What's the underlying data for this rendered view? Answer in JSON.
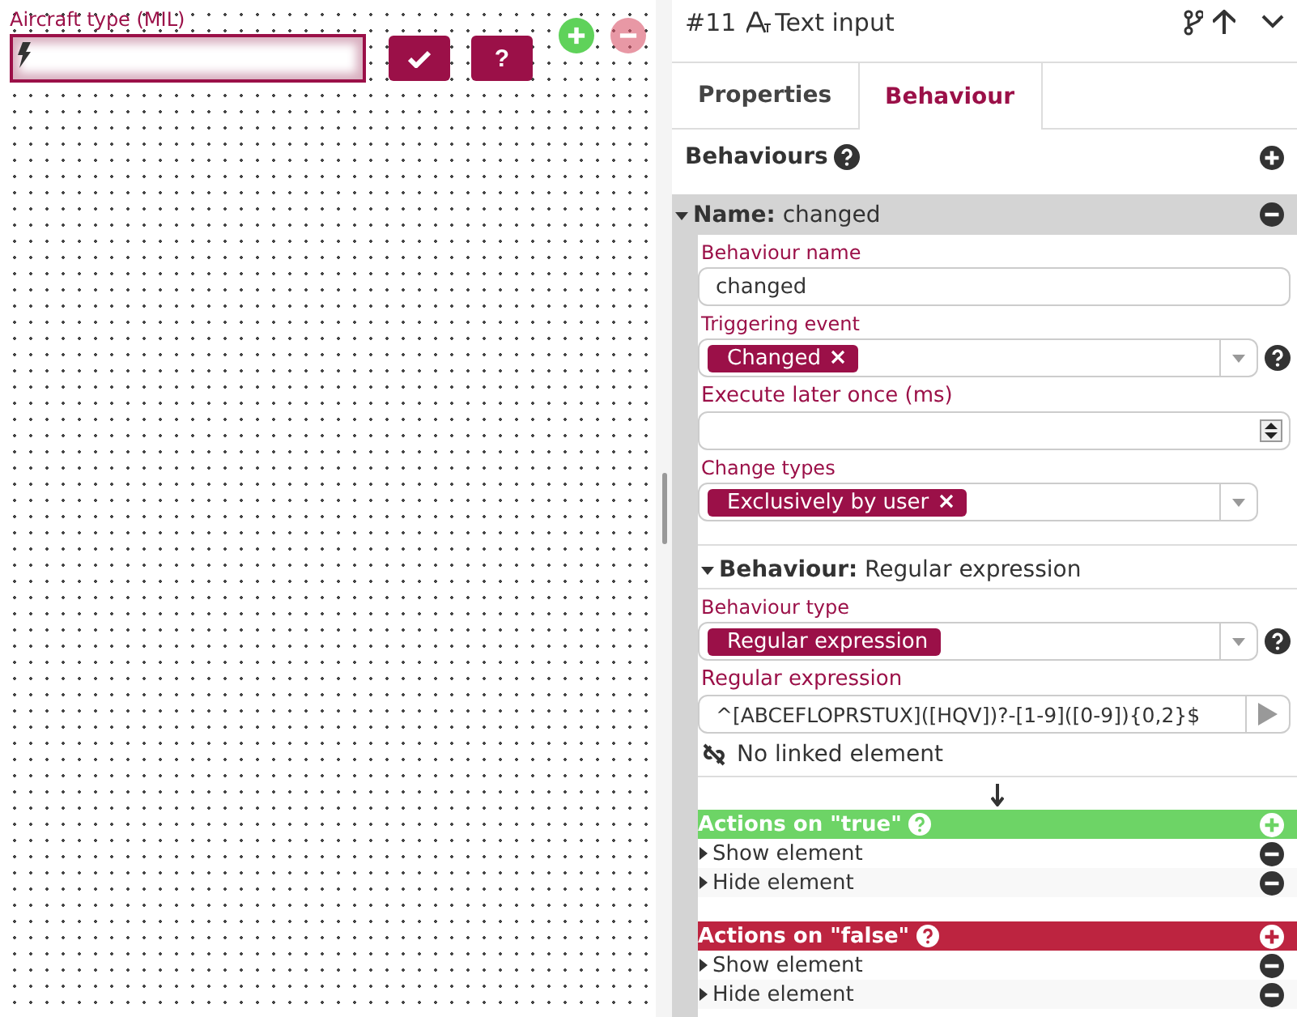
{
  "canvas": {
    "field_label": "Aircraft type (MIL)",
    "buttons": [
      {
        "kind": "check"
      },
      {
        "kind": "help",
        "label": "?"
      }
    ],
    "controls": [
      {
        "kind": "add",
        "disabled": false
      },
      {
        "kind": "remove",
        "disabled": true
      }
    ]
  },
  "panel": {
    "header": {
      "number": "#11",
      "title": "Text input"
    },
    "tabs": [
      {
        "label": "Properties",
        "selected": false
      },
      {
        "label": "Behaviour",
        "selected": true
      }
    ],
    "section_title": "Behaviours",
    "behaviour": {
      "name_key": "Name:",
      "name": "changed",
      "expanded": true,
      "fields": [
        {
          "kind": "text",
          "label": "Behaviour name",
          "value": "changed"
        },
        {
          "kind": "tags",
          "label": "Triggering event",
          "tags": [
            "Changed"
          ],
          "help": true
        },
        {
          "kind": "number",
          "label": "Execute later once (ms)"
        },
        {
          "kind": "tags",
          "label": "Change types",
          "tags": [
            "Exclusively by user"
          ],
          "help": false
        }
      ],
      "sub": {
        "key": "Behaviour:",
        "name": "Regular expression",
        "expanded": true,
        "fields": [
          {
            "kind": "select",
            "label": "Behaviour type",
            "tags": [
              "Regular expression"
            ],
            "help": true
          },
          {
            "kind": "regex",
            "label": "Regular expression",
            "value": "^[ABCEFLOPRSTUX]([HQV])?-[1-9]([0-9]){0,2}$"
          }
        ],
        "linked": "No linked element",
        "groups": [
          {
            "title": "Actions on \"true\"",
            "color": "#6dd466",
            "actions": [
              "Show element",
              "Hide element"
            ]
          },
          {
            "title": "Actions on \"false\"",
            "color": "#bd2440",
            "actions": [
              "Show element",
              "Hide element"
            ]
          }
        ]
      }
    }
  }
}
